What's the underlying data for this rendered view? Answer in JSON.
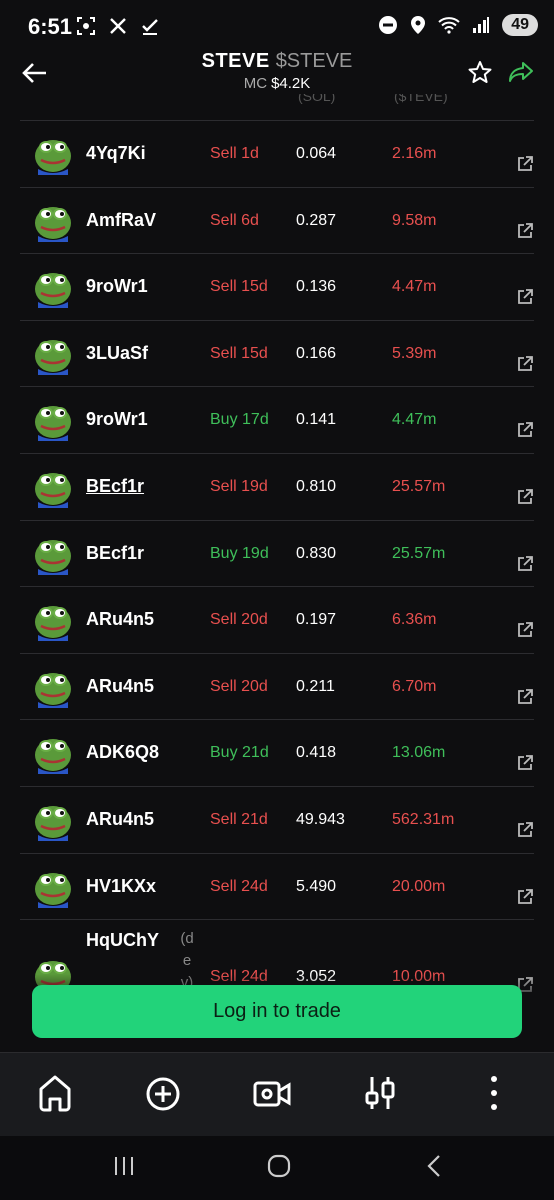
{
  "status_bar": {
    "time": "6:51",
    "left_icons": [
      "screenshot-icon",
      "x-logo-icon",
      "check-icon"
    ],
    "right_icons": [
      "do-not-disturb-icon",
      "location-icon",
      "wifi-icon",
      "signal-icon"
    ],
    "battery": "49"
  },
  "header": {
    "token_name": "STEVE",
    "token_symbol": "$STEVE",
    "mc_label": "MC",
    "mc_value": "$4.2K",
    "partial_col1": "(SOL)",
    "partial_col2": "($TEVE)"
  },
  "trades": [
    {
      "wallet": "4Yq7Ki",
      "side": "Sell 1d",
      "type": "sell",
      "amount": "0.064",
      "tokens": "2.16m"
    },
    {
      "wallet": "AmfRaV",
      "side": "Sell 6d",
      "type": "sell",
      "amount": "0.287",
      "tokens": "9.58m"
    },
    {
      "wallet": "9roWr1",
      "side": "Sell 15d",
      "type": "sell",
      "amount": "0.136",
      "tokens": "4.47m"
    },
    {
      "wallet": "3LUaSf",
      "side": "Sell 15d",
      "type": "sell",
      "amount": "0.166",
      "tokens": "5.39m"
    },
    {
      "wallet": "9roWr1",
      "side": "Buy 17d",
      "type": "buy",
      "amount": "0.141",
      "tokens": "4.47m"
    },
    {
      "wallet": "BEcf1r",
      "side": "Sell 19d",
      "type": "sell",
      "amount": "0.810",
      "tokens": "25.57m",
      "underline": true
    },
    {
      "wallet": "BEcf1r",
      "side": "Buy 19d",
      "type": "buy",
      "amount": "0.830",
      "tokens": "25.57m"
    },
    {
      "wallet": "ARu4n5",
      "side": "Sell 20d",
      "type": "sell",
      "amount": "0.197",
      "tokens": "6.36m"
    },
    {
      "wallet": "ARu4n5",
      "side": "Sell 20d",
      "type": "sell",
      "amount": "0.211",
      "tokens": "6.70m"
    },
    {
      "wallet": "ADK6Q8",
      "side": "Buy 21d",
      "type": "buy",
      "amount": "0.418",
      "tokens": "13.06m"
    },
    {
      "wallet": "ARu4n5",
      "side": "Sell 21d",
      "type": "sell",
      "amount": "49.943",
      "tokens": "562.31m"
    },
    {
      "wallet": "HV1KXx",
      "side": "Sell 24d",
      "type": "sell",
      "amount": "5.490",
      "tokens": "20.00m"
    },
    {
      "wallet": "HqUChY",
      "side": "Sell 24d",
      "type": "sell",
      "amount": "3.052",
      "tokens": "10.00m",
      "dev": "(dev)"
    }
  ],
  "login_button": "Log in to trade",
  "bottom_nav": [
    "home-icon",
    "add-circle-icon",
    "video-icon",
    "chart-candles-icon",
    "more-vertical-icon"
  ],
  "system_nav": [
    "recent-apps-icon",
    "home-circle-icon",
    "back-chevron-icon"
  ],
  "colors": {
    "sell": "#e8504f",
    "buy": "#3fbf5a",
    "accent": "#22d37a"
  }
}
